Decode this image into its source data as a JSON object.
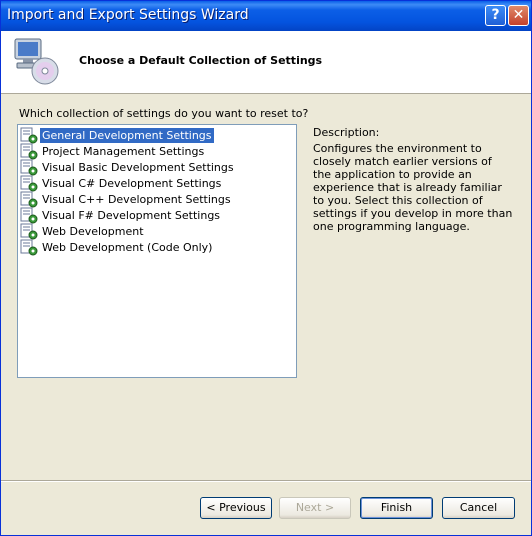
{
  "window": {
    "title": "Import and Export Settings Wizard"
  },
  "titlebar": {
    "help_label": "?",
    "close_label": "✕"
  },
  "header": {
    "title": "Choose a Default Collection of Settings",
    "icon": "computer-disc-icon"
  },
  "main": {
    "prompt": "Which collection of settings do you want to reset to?",
    "items": [
      {
        "label": "General Development Settings",
        "selected": true
      },
      {
        "label": "Project Management Settings"
      },
      {
        "label": "Visual Basic Development Settings"
      },
      {
        "label": "Visual C# Development Settings"
      },
      {
        "label": "Visual C++ Development Settings"
      },
      {
        "label": "Visual F# Development Settings"
      },
      {
        "label": "Web Development"
      },
      {
        "label": "Web Development (Code Only)"
      }
    ],
    "description_title": "Description:",
    "description_text": "Configures the environment to closely match earlier versions of the application to provide an experience that is already familiar to you. Select this collection of settings if you develop in more than one programming language."
  },
  "buttons": {
    "previous": "< Previous",
    "next": "Next >",
    "finish": "Finish",
    "cancel": "Cancel"
  },
  "colors": {
    "titlebar": "#0454df",
    "selection": "#316ac5",
    "dialog_bg": "#ece9d8"
  }
}
